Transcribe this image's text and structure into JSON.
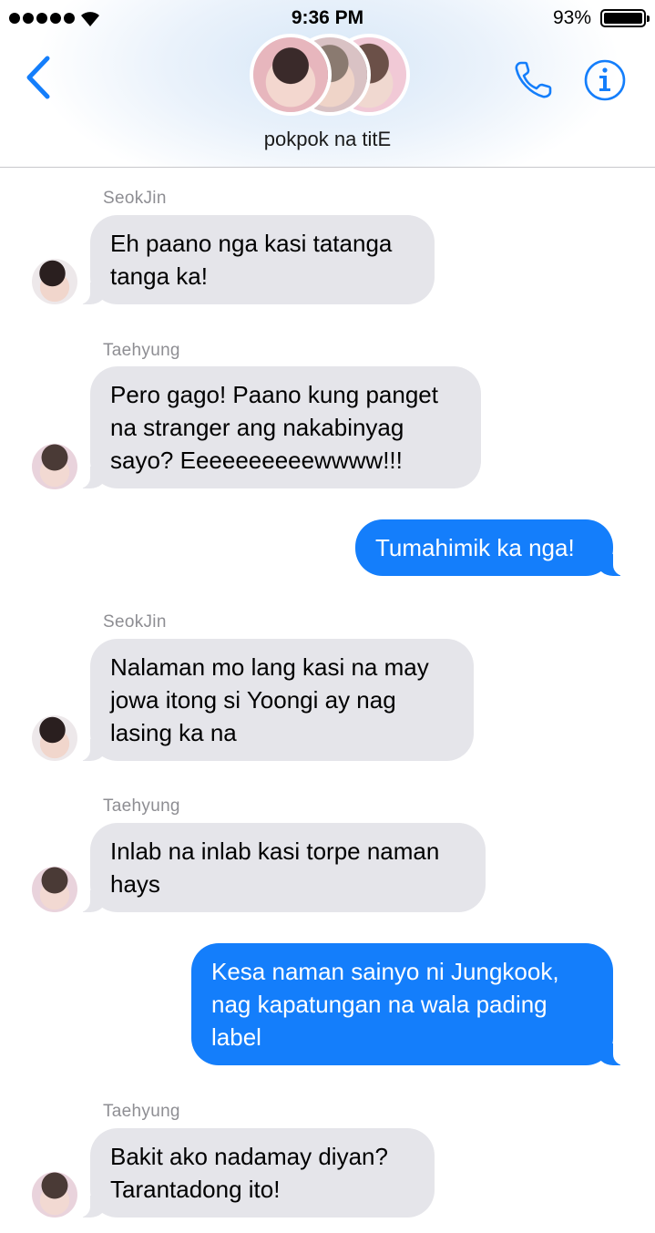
{
  "status_bar": {
    "time": "9:36 PM",
    "battery_percent": "93%",
    "battery_level": 0.93,
    "signal_bars": 5,
    "wifi_icon": "wifi-icon"
  },
  "header": {
    "group_name": "pokpok na titE",
    "back_icon": "chevron-left-icon",
    "call_icon": "phone-icon",
    "info_icon": "info-icon",
    "accent_color": "#147efb"
  },
  "messages": [
    {
      "direction": "incoming",
      "sender": "SeokJin",
      "text": "Eh paano nga kasi tatanga tanga ka!"
    },
    {
      "direction": "incoming",
      "sender": "Taehyung",
      "text": "Pero gago! Paano kung panget na stranger ang nakabinyag sayo? Eeeeeeeeeewwww!!!"
    },
    {
      "direction": "outgoing",
      "sender": "",
      "text": "Tumahimik ka nga!"
    },
    {
      "direction": "incoming",
      "sender": "SeokJin",
      "text": "Nalaman mo lang kasi na may jowa itong si Yoongi ay nag lasing ka na"
    },
    {
      "direction": "incoming",
      "sender": "Taehyung",
      "text": "Inlab na inlab kasi torpe naman hays"
    },
    {
      "direction": "outgoing",
      "sender": "",
      "text": "Kesa naman sainyo ni Jungkook, nag kapatungan na wala pading label"
    },
    {
      "direction": "incoming",
      "sender": "Taehyung",
      "text": "Bakit ako nadamay diyan? Tarantadong ito!"
    }
  ],
  "colors": {
    "incoming_bubble": "#e5e5ea",
    "outgoing_bubble": "#147efb",
    "sender_label": "#8e8e93"
  }
}
